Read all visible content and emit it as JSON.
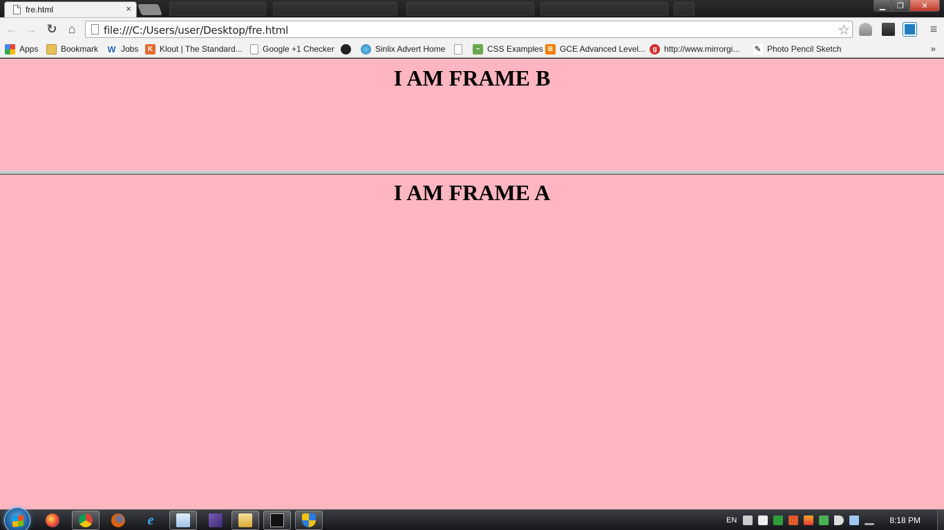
{
  "browser": {
    "tab": {
      "title": "fre.html",
      "close": "×"
    },
    "window_controls": {
      "minimize": "▁",
      "maximize": "❐",
      "close": "✕"
    },
    "toolbar": {
      "back": "←",
      "forward": "→",
      "reload": "↻",
      "home": "⌂",
      "url": "file:///C:/Users/user/Desktop/fre.html",
      "star": "☆",
      "menu": "≡"
    },
    "bookmarks": [
      {
        "label": "Apps",
        "icon": "apps-grid-icon"
      },
      {
        "label": "Bookmark",
        "icon": "folder-icon"
      },
      {
        "label": "Jobs",
        "icon": "w-logo-icon"
      },
      {
        "label": "Klout | The Standard...",
        "icon": "klout-icon"
      },
      {
        "label": "Google +1 Checker",
        "icon": "page-icon"
      },
      {
        "label": "",
        "icon": "satellite-icon"
      },
      {
        "label": "Sinlix Advert Home",
        "icon": "globe-icon"
      },
      {
        "label": "",
        "icon": "page-icon"
      },
      {
        "label": "CSS Examples",
        "icon": "css-icon"
      },
      {
        "label": "GCE Advanced Level...",
        "icon": "blogger-icon"
      },
      {
        "label": "http://www.mirrorgi...",
        "icon": "mirror-icon"
      },
      {
        "label": "Photo Pencil Sketch",
        "icon": "pencil-icon"
      }
    ],
    "bookmarks_overflow": "»"
  },
  "page": {
    "frame_b": {
      "heading": "I AM FRAME B"
    },
    "frame_a": {
      "heading": "I AM FRAME A"
    },
    "background": "#ffb6c1"
  },
  "taskbar": {
    "language": "EN",
    "clock": "8:18 PM"
  }
}
